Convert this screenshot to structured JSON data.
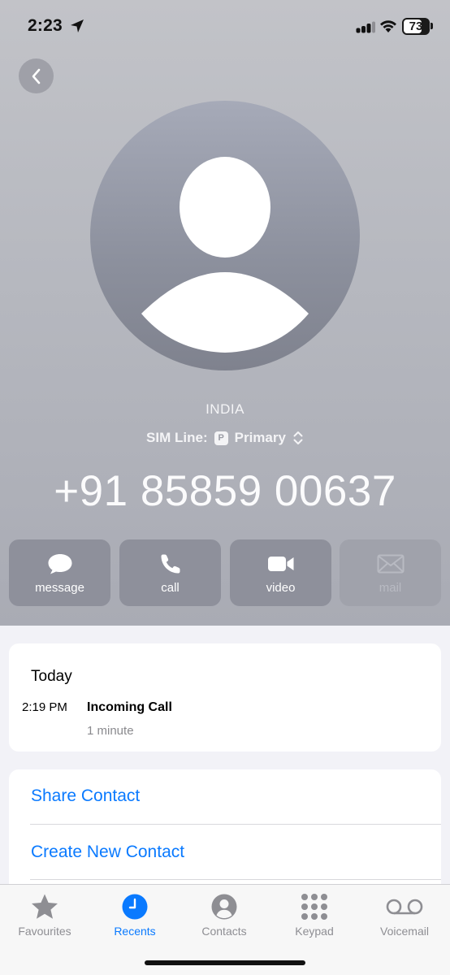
{
  "status_bar": {
    "time": "2:23",
    "battery": "73",
    "battery_level": 0.73
  },
  "header": {
    "back_icon": "chevron-left-icon"
  },
  "contact": {
    "country": "INDIA",
    "sim_line_label": "SIM Line:",
    "sim_badge": "P",
    "sim_name": "Primary",
    "phone_number": "+91 85859 00637"
  },
  "actions": [
    {
      "label": "message",
      "icon": "message-bubble-icon",
      "enabled": true
    },
    {
      "label": "call",
      "icon": "phone-icon",
      "enabled": true
    },
    {
      "label": "video",
      "icon": "video-camera-icon",
      "enabled": true
    },
    {
      "label": "mail",
      "icon": "envelope-icon",
      "enabled": false
    }
  ],
  "recent": {
    "heading": "Today",
    "time": "2:19 PM",
    "type": "Incoming Call",
    "duration": "1 minute"
  },
  "options": [
    {
      "label": "Share Contact"
    },
    {
      "label": "Create New Contact"
    }
  ],
  "tabs": [
    {
      "label": "Favourites",
      "icon": "star-icon",
      "active": false
    },
    {
      "label": "Recents",
      "icon": "clock-icon",
      "active": true
    },
    {
      "label": "Contacts",
      "icon": "person-circle-icon",
      "active": false
    },
    {
      "label": "Keypad",
      "icon": "keypad-icon",
      "active": false
    },
    {
      "label": "Voicemail",
      "icon": "voicemail-icon",
      "active": false
    }
  ],
  "colors": {
    "accent": "#0a7aff",
    "hero_background": "#b7b9c0",
    "action_button": "#8e909b"
  }
}
